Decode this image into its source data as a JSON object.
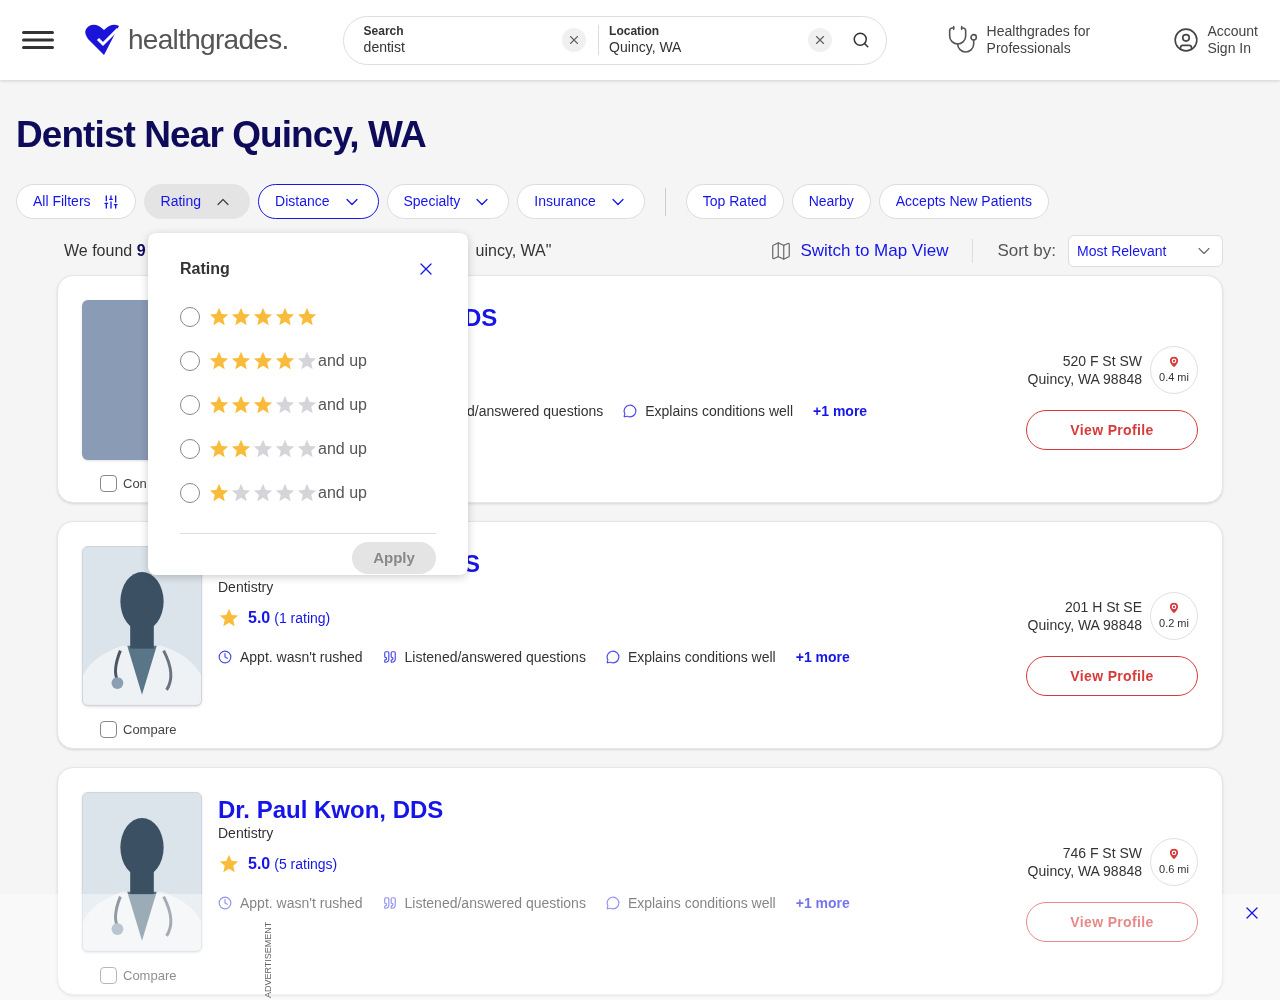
{
  "header": {
    "logo_text": "healthgrades.",
    "search": {
      "label": "Search",
      "value": "dentist"
    },
    "location": {
      "label": "Location",
      "value": "Quincy, WA"
    },
    "pro_link": "Healthgrades for Professionals",
    "account": {
      "line1": "Account",
      "line2": "Sign In"
    }
  },
  "title": "Dentist Near Quincy, WA",
  "filters": [
    {
      "kind": "all",
      "label": "All Filters"
    },
    {
      "kind": "dropdown",
      "label": "Rating",
      "expanded": true,
      "focused": false
    },
    {
      "kind": "dropdown",
      "label": "Distance",
      "expanded": false,
      "focused": true
    },
    {
      "kind": "dropdown",
      "label": "Specialty",
      "expanded": false,
      "focused": false
    },
    {
      "kind": "dropdown",
      "label": "Insurance",
      "expanded": false,
      "focused": false
    },
    {
      "kind": "toggle",
      "label": "Top Rated",
      "selected": false
    },
    {
      "kind": "toggle",
      "label": "Nearby",
      "selected": false
    },
    {
      "kind": "toggle",
      "label": "Accepts New Patients",
      "selected": false
    }
  ],
  "summary": {
    "lead": "We found **9**",
    "tail": "uincy, WA\""
  },
  "map_link": "Switch to Map View",
  "sort": {
    "label": "Sort by:",
    "value": "Most Relevant"
  },
  "rating_popover": {
    "title": "Rating",
    "options": [
      {
        "stars": 5,
        "selected": false
      },
      {
        "stars": 4,
        "suffix": "and up",
        "selected": false
      },
      {
        "stars": 3,
        "suffix": "and up",
        "selected": false
      },
      {
        "stars": 2,
        "suffix": "and up",
        "selected": false
      },
      {
        "stars": 1,
        "suffix": "and up",
        "selected": false
      }
    ],
    "apply": {
      "label": "Apply",
      "disabled": true
    }
  },
  "doctors": [
    {
      "kind": "photo",
      "name": "DS",
      "tags": [
        {
          "kind": "text",
          "text": "d/answered questions"
        },
        {
          "kind": "explains",
          "text": "Explains conditions well"
        }
      ],
      "more": "+1 more",
      "address1": "520 F St SW",
      "address2": "Quincy, WA 98848",
      "distance": "0.4 mi",
      "button": "View Profile",
      "compare": "Con",
      "compared": false
    },
    {
      "kind": "silhouette",
      "name": "S",
      "specialty": "Dentistry",
      "rating": "5.0",
      "rating_count": "(1 rating)",
      "tags": [
        {
          "kind": "rushed",
          "text": "Appt. wasn't rushed"
        },
        {
          "kind": "listened",
          "text": "Listened/answered questions"
        },
        {
          "kind": "explains",
          "text": "Explains conditions well"
        }
      ],
      "more": "+1 more",
      "address1": "201 H St SE",
      "address2": "Quincy, WA 98848",
      "distance": "0.2 mi",
      "button": "View Profile",
      "compare": "Compare",
      "compared": false
    },
    {
      "kind": "silhouette",
      "name": "Dr. Paul Kwon, DDS",
      "specialty": "Dentistry",
      "rating": "5.0",
      "rating_count": "(5 ratings)",
      "tags": [
        {
          "kind": "rushed",
          "text": "Appt. wasn't rushed"
        },
        {
          "kind": "listened",
          "text": "Listened/answered questions"
        },
        {
          "kind": "explains",
          "text": "Explains conditions well"
        }
      ],
      "more": "+1 more",
      "address1": "746 F St SW",
      "address2": "Quincy, WA 98848",
      "distance": "0.6 mi",
      "button": "View Profile",
      "compare": "Compare",
      "compared": false
    }
  ],
  "ad": {
    "label": "ADVERTISEMENT"
  }
}
